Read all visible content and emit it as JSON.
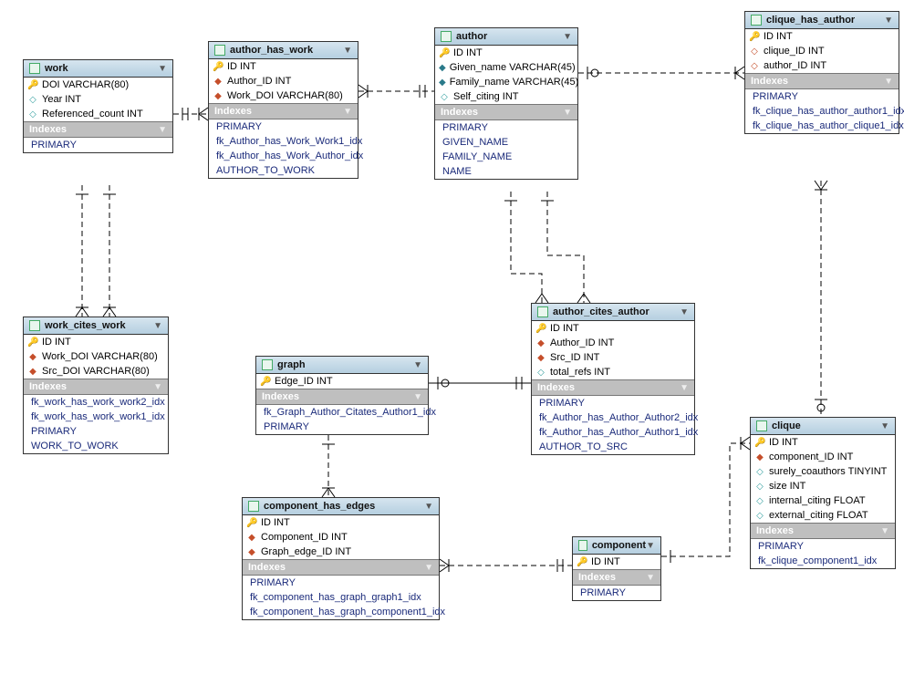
{
  "labels": {
    "indexes": "Indexes"
  },
  "entities": {
    "work": {
      "name": "work",
      "columns": [
        "DOI VARCHAR(80)",
        "Year INT",
        "Referenced_count INT"
      ],
      "indexes": [
        "PRIMARY"
      ]
    },
    "author_has_work": {
      "name": "author_has_work",
      "columns": [
        "ID INT",
        "Author_ID INT",
        "Work_DOI VARCHAR(80)"
      ],
      "indexes": [
        "PRIMARY",
        "fk_Author_has_Work_Work1_idx",
        "fk_Author_has_Work_Author_idx",
        "AUTHOR_TO_WORK"
      ]
    },
    "author": {
      "name": "author",
      "columns": [
        "ID INT",
        "Given_name VARCHAR(45)",
        "Family_name VARCHAR(45)",
        "Self_citing INT"
      ],
      "indexes": [
        "PRIMARY",
        "GIVEN_NAME",
        "FAMILY_NAME",
        "NAME"
      ]
    },
    "clique_has_author": {
      "name": "clique_has_author",
      "columns": [
        "ID INT",
        "clique_ID INT",
        "author_ID INT"
      ],
      "indexes": [
        "PRIMARY",
        "fk_clique_has_author_author1_idx",
        "fk_clique_has_author_clique1_idx"
      ]
    },
    "work_cites_work": {
      "name": "work_cites_work",
      "columns": [
        "ID INT",
        "Work_DOI VARCHAR(80)",
        "Src_DOI VARCHAR(80)"
      ],
      "indexes": [
        "fk_work_has_work_work2_idx",
        "fk_work_has_work_work1_idx",
        "PRIMARY",
        "WORK_TO_WORK"
      ]
    },
    "graph": {
      "name": "graph",
      "columns": [
        "Edge_ID INT"
      ],
      "indexes": [
        "fk_Graph_Author_Citates_Author1_idx",
        "PRIMARY"
      ]
    },
    "author_cites_author": {
      "name": "author_cites_author",
      "columns": [
        "ID INT",
        "Author_ID INT",
        "Src_ID INT",
        "total_refs INT"
      ],
      "indexes": [
        "PRIMARY",
        "fk_Author_has_Author_Author2_idx",
        "fk_Author_has_Author_Author1_idx",
        "AUTHOR_TO_SRC"
      ]
    },
    "component_has_edges": {
      "name": "component_has_edges",
      "columns": [
        "ID INT",
        "Component_ID INT",
        "Graph_edge_ID INT"
      ],
      "indexes": [
        "PRIMARY",
        "fk_component_has_graph_graph1_idx",
        "fk_component_has_graph_component1_idx"
      ]
    },
    "component": {
      "name": "component",
      "columns": [
        "ID INT"
      ],
      "indexes": [
        "PRIMARY"
      ]
    },
    "clique": {
      "name": "clique",
      "columns": [
        "ID INT",
        "component_ID INT",
        "surely_coauthors TINYINT",
        "size INT",
        "internal_citing FLOAT",
        "external_citing FLOAT"
      ],
      "indexes": [
        "PRIMARY",
        "fk_clique_component1_idx"
      ]
    }
  }
}
